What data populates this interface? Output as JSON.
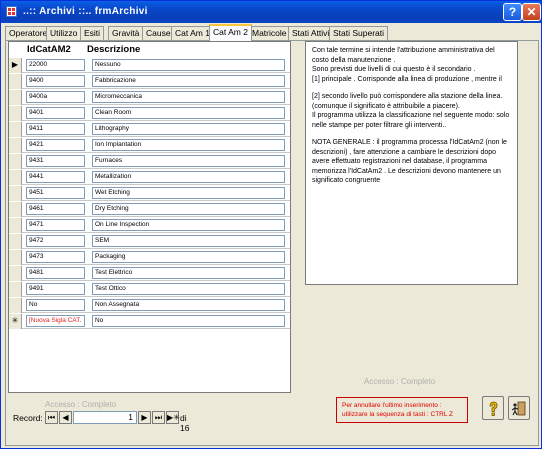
{
  "window": {
    "title": "..:: Archivi ::..  frmArchivi",
    "help_label": "?",
    "close_label": "✕"
  },
  "tabs": [
    {
      "label": "Operatore"
    },
    {
      "label": "Utilizzo"
    },
    {
      "label": "Esiti"
    },
    {
      "label": "Gravità"
    },
    {
      "label": "Cause"
    },
    {
      "label": "Cat Am 1"
    },
    {
      "label": "Cat Am 2"
    },
    {
      "label": "Matricole"
    },
    {
      "label": "Stati Attivi"
    },
    {
      "label": "Stati Superati"
    }
  ],
  "active_tab": "Cat Am 2",
  "grid": {
    "headers": {
      "col1": "IdCatAM2",
      "col2": "Descrizione"
    },
    "rows": [
      {
        "id": "22000",
        "desc": "Nessuno"
      },
      {
        "id": "9400",
        "desc": "Fabbricazione"
      },
      {
        "id": "9400a",
        "desc": "Micromeccanica"
      },
      {
        "id": "9401",
        "desc": "Clean Room"
      },
      {
        "id": "9411",
        "desc": "Lithography"
      },
      {
        "id": "9421",
        "desc": "Ion Implantation"
      },
      {
        "id": "9431",
        "desc": "Furnaces"
      },
      {
        "id": "9441",
        "desc": "Metallization"
      },
      {
        "id": "9451",
        "desc": "Wet Etching"
      },
      {
        "id": "9461",
        "desc": "Dry Etching"
      },
      {
        "id": "9471",
        "desc": "On Line Inspection"
      },
      {
        "id": "9472",
        "desc": "SEM"
      },
      {
        "id": "9473",
        "desc": "Packaging"
      },
      {
        "id": "9481",
        "desc": "Test Elettrico"
      },
      {
        "id": "9491",
        "desc": "Test Ottico"
      },
      {
        "id": "No",
        "desc": "Non Assegnata"
      }
    ],
    "new_row": {
      "id": "[Nuova Sigla CAT.",
      "desc": "No"
    },
    "current_marker": "▶",
    "new_marker": "✳"
  },
  "access": {
    "left": "Accesso : Completo",
    "right": "Accesso : Completo"
  },
  "navigator": {
    "label": "Record:",
    "current": "1",
    "of_label": "di 16",
    "first": "⏮",
    "prev": "◀",
    "next": "▶",
    "last": "⏭",
    "new": "▶✳"
  },
  "notes": {
    "p1": "Con tale termine si intende l'attribuzione amministrativa del costo della manutenzione .",
    "p2": "Sono previsti due livelli di cui questo è il secondario .",
    "p3": "[1] principale . Corrisponde alla linea di produzione , mentre il",
    "p4": "[2] secondo livello può corrispondere alla stazione della linea. (comunque il significato è attribuibile a piacere).",
    "p5": "Il programma utilizza la classificazione nel seguente modo: solo nelle stampe per poter filtrare gli interventi..",
    "p6": "NOTA GENERALE : il programma processa l'IdCatAm2 (non le descrizioni) ,  fare attenzione a cambiare le descrizioni dopo avere effettuato registrazioni nel database, il programma memorizza l'IdCatAm2 . Le descrizioni devono mantenere un significato congruente"
  },
  "undo_hint": {
    "line1": "Per annullare l'ultimo inserimento :",
    "line2": "utilizzare la sequenza di tasti :   CTRL   Z"
  },
  "buttons": {
    "help_icon": "help-icon",
    "exit_icon": "exit-icon"
  }
}
